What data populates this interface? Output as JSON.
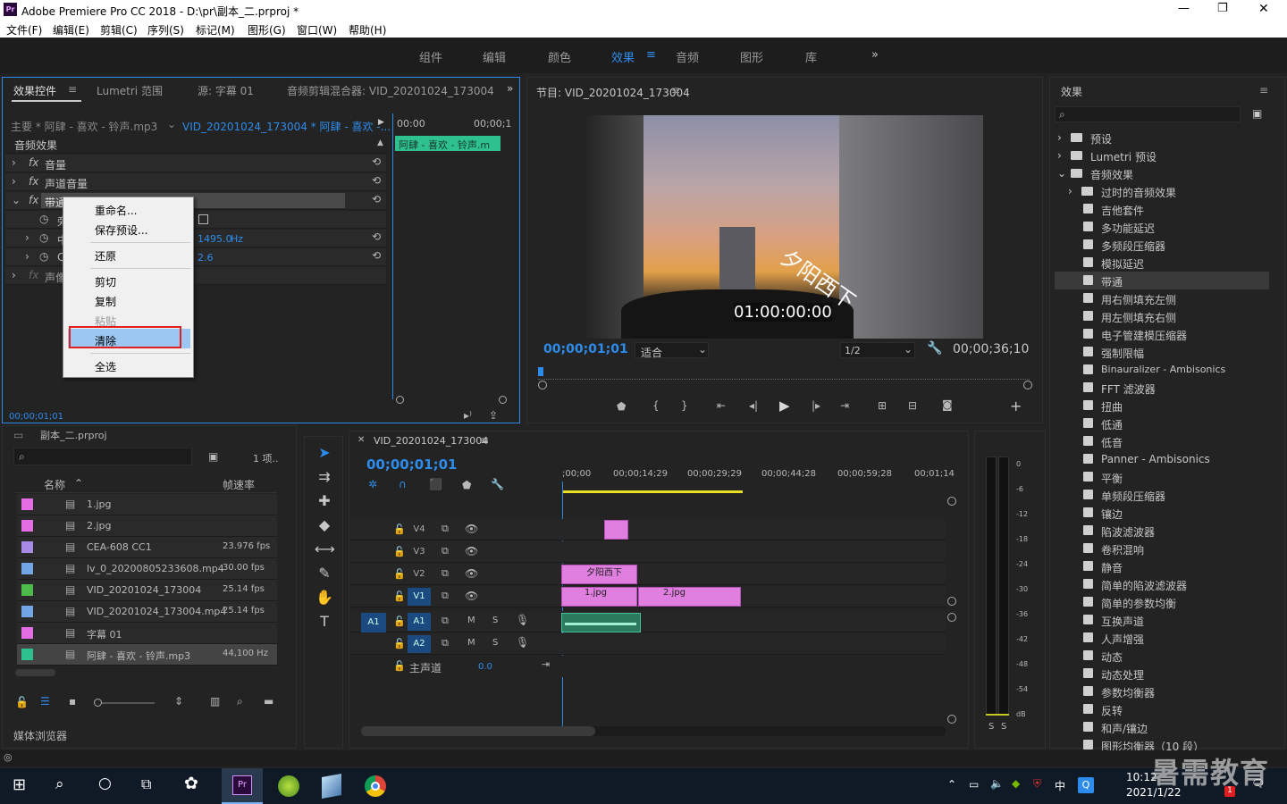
{
  "app": {
    "title": "Adobe Premiere Pro CC 2018 - D:\\pr\\副本_二.prproj *",
    "logo": "Pr"
  },
  "window_controls": {
    "minimize": "—",
    "maximize": "❐",
    "close": "✕"
  },
  "menu": [
    "文件(F)",
    "编辑(E)",
    "剪辑(C)",
    "序列(S)",
    "标记(M)",
    "图形(G)",
    "窗口(W)",
    "帮助(H)"
  ],
  "workspace_tabs": [
    "组件",
    "编辑",
    "颜色",
    "效果",
    "音频",
    "图形",
    "库"
  ],
  "workspace_active": "效果",
  "workspace_more": "»",
  "effect_controls": {
    "tabs": [
      "效果控件",
      "Lumetri 范围",
      "源: 字幕 01",
      "音频剪辑混合器: VID_20201024_173004"
    ],
    "master": "主要 * 阿肆 - 喜欢 - 铃声.mp3",
    "sequence_clip": "VID_20201024_173004 * 阿肆 - 喜欢 -...",
    "section": "音频效果",
    "effects": [
      "音量",
      "声道音量",
      "带通",
      "声像"
    ],
    "params": [
      {
        "label": "旁",
        "value": ""
      },
      {
        "label": "中",
        "value": "1495.0",
        "unit": "Hz"
      },
      {
        "label": "Q",
        "value": "2.6"
      }
    ],
    "timecodes": {
      "start": "00:00",
      "end": "00;00;1"
    },
    "clip_label": "阿肆 - 喜欢 - 铃声.m",
    "footer_tc": "00;00;01;01"
  },
  "context_menu": [
    "重命名...",
    "保存预设...",
    "还原",
    "剪切",
    "复制",
    "粘贴",
    "清除",
    "全选"
  ],
  "context_menu_disabled": [
    "粘贴"
  ],
  "context_menu_highlight": "清除",
  "program": {
    "title": "节目: VID_20201024_173004",
    "overlay_text": "夕阳西下",
    "video_tc": "01:00:00:00",
    "current_tc": "00;00;01;01",
    "fit": "适合",
    "resolution": "1/2",
    "duration": "00;00;36;10"
  },
  "effects_panel": {
    "title": "效果",
    "items": [
      {
        "label": "预设",
        "indent": 0,
        "type": "folder",
        "exp": "›"
      },
      {
        "label": "Lumetri 预设",
        "indent": 0,
        "type": "folder",
        "exp": "›"
      },
      {
        "label": "音频效果",
        "indent": 0,
        "type": "folder",
        "exp": "⌄"
      },
      {
        "label": "过时的音频效果",
        "indent": 1,
        "type": "folder",
        "exp": "›"
      },
      {
        "label": "吉他套件",
        "indent": 1,
        "type": "fx"
      },
      {
        "label": "多功能延迟",
        "indent": 1,
        "type": "fx"
      },
      {
        "label": "多频段压缩器",
        "indent": 1,
        "type": "fx"
      },
      {
        "label": "模拟延迟",
        "indent": 1,
        "type": "fx"
      },
      {
        "label": "带通",
        "indent": 1,
        "type": "fx",
        "selected": true
      },
      {
        "label": "用右侧填充左侧",
        "indent": 1,
        "type": "fx"
      },
      {
        "label": "用左侧填充右侧",
        "indent": 1,
        "type": "fx"
      },
      {
        "label": "电子管建模压缩器",
        "indent": 1,
        "type": "fx"
      },
      {
        "label": "强制限幅",
        "indent": 1,
        "type": "fx"
      },
      {
        "label": "Binauralizer - Ambisonics",
        "indent": 1,
        "type": "fx"
      },
      {
        "label": "FFT 滤波器",
        "indent": 1,
        "type": "fx"
      },
      {
        "label": "扭曲",
        "indent": 1,
        "type": "fx"
      },
      {
        "label": "低通",
        "indent": 1,
        "type": "fx"
      },
      {
        "label": "低音",
        "indent": 1,
        "type": "fx"
      },
      {
        "label": "Panner - Ambisonics",
        "indent": 1,
        "type": "fx"
      },
      {
        "label": "平衡",
        "indent": 1,
        "type": "fx"
      },
      {
        "label": "单频段压缩器",
        "indent": 1,
        "type": "fx"
      },
      {
        "label": "镶边",
        "indent": 1,
        "type": "fx"
      },
      {
        "label": "陷波滤波器",
        "indent": 1,
        "type": "fx"
      },
      {
        "label": "卷积混响",
        "indent": 1,
        "type": "fx"
      },
      {
        "label": "静音",
        "indent": 1,
        "type": "fx"
      },
      {
        "label": "简单的陷波滤波器",
        "indent": 1,
        "type": "fx"
      },
      {
        "label": "简单的参数均衡",
        "indent": 1,
        "type": "fx"
      },
      {
        "label": "互换声道",
        "indent": 1,
        "type": "fx"
      },
      {
        "label": "人声增强",
        "indent": 1,
        "type": "fx"
      },
      {
        "label": "动态",
        "indent": 1,
        "type": "fx"
      },
      {
        "label": "动态处理",
        "indent": 1,
        "type": "fx"
      },
      {
        "label": "参数均衡器",
        "indent": 1,
        "type": "fx"
      },
      {
        "label": "反转",
        "indent": 1,
        "type": "fx"
      },
      {
        "label": "和声/镶边",
        "indent": 1,
        "type": "fx"
      },
      {
        "label": "图形均衡器（10 段）",
        "indent": 1,
        "type": "fx"
      }
    ]
  },
  "project": {
    "title": "副本_二.prproj",
    "count": "1 项..",
    "col_name": "名称",
    "col_fps": "帧速率",
    "items": [
      {
        "name": "1.jpg",
        "fps": "",
        "color": "#e36ee3"
      },
      {
        "name": "2.jpg",
        "fps": "",
        "color": "#e36ee3"
      },
      {
        "name": "CEA-608 CC1",
        "fps": "23.976 fps",
        "color": "#a68ae3"
      },
      {
        "name": "lv_0_20200805233608.mp4",
        "fps": "30.00 fps",
        "color": "#6fa6e3"
      },
      {
        "name": "VID_20201024_173004",
        "fps": "25.14 fps",
        "color": "#4cbb4c"
      },
      {
        "name": "VID_20201024_173004.mp4",
        "fps": "25.14 fps",
        "color": "#6fa6e3"
      },
      {
        "name": "字幕 01",
        "fps": "",
        "color": "#e36ee3"
      },
      {
        "name": "阿肆 - 喜欢 - 铃声.mp3",
        "fps": "44,100 Hz",
        "color": "#2ec08e",
        "selected": true
      }
    ],
    "footer": "媒体浏览器"
  },
  "timeline": {
    "title": "VID_20201024_173004",
    "timecode": "00;00;01;01",
    "ruler": [
      ";00;00",
      "00;00;14;29",
      "00;00;29;29",
      "00;00;44;28",
      "00;00;59;28",
      "00;01;14"
    ],
    "video_tracks": [
      "V4",
      "V3",
      "V2",
      "V1"
    ],
    "audio_tracks": [
      "A1",
      "A2"
    ],
    "master_label": "主声道",
    "master_value": "0.0",
    "clips": {
      "v2": "夕阳西下",
      "v1a": "1.jpg",
      "v1b": "2.jpg"
    }
  },
  "meter": {
    "scale": [
      "0",
      "-6",
      "-12",
      "-18",
      "-24",
      "-30",
      "-36",
      "-42",
      "-48",
      "-54",
      "dB"
    ],
    "solo": [
      "S",
      "S"
    ]
  },
  "taskbar": {
    "time": "10:12",
    "date": "2021/1/22",
    "ime": "中",
    "badge": "1"
  },
  "watermark": "暑需教育"
}
